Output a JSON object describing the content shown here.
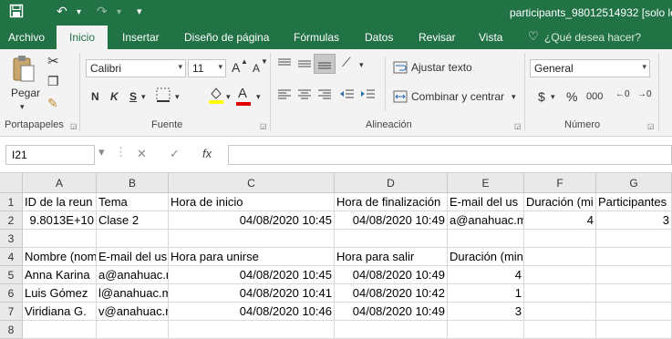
{
  "window": {
    "title": "participants_98012514932  [solo le"
  },
  "tabs": [
    "Archivo",
    "Inicio",
    "Insertar",
    "Diseño de página",
    "Fórmulas",
    "Datos",
    "Revisar",
    "Vista"
  ],
  "tell_me": "¿Qué desea hacer?",
  "ribbon": {
    "paste_label": "Pegar",
    "font_name": "Calibri",
    "font_size": "11",
    "grow_font": "A",
    "shrink_font": "A",
    "bold": "N",
    "italic": "K",
    "underline": "S",
    "wrap_text": "Ajustar texto",
    "merge_center": "Combinar y centrar",
    "number_format": "General",
    "currency": "$",
    "percent": "%",
    "thousands": "000",
    "groups": {
      "clipboard": "Portapapeles",
      "font": "Fuente",
      "alignment": "Alineación",
      "number": "Número"
    }
  },
  "formula_bar": {
    "name_box": "I21",
    "cancel": "✕",
    "enter": "✓",
    "fx": "fx",
    "value": ""
  },
  "columns": [
    "A",
    "B",
    "C",
    "D",
    "E",
    "F",
    "G"
  ],
  "rows": [
    {
      "num": "1",
      "cells": [
        "ID de la reun",
        "Tema",
        "Hora de inicio",
        "Hora de finalización",
        "E-mail del us",
        "Duración (mi",
        "Participantes"
      ]
    },
    {
      "num": "2",
      "cells": [
        "9.8013E+10",
        "Clase 2",
        "04/08/2020 10:45",
        "04/08/2020 10:49",
        "a@anahuac.m",
        "4",
        "3"
      ]
    },
    {
      "num": "3",
      "cells": [
        "",
        "",
        "",
        "",
        "",
        "",
        ""
      ]
    },
    {
      "num": "4",
      "cells": [
        "Nombre (nom",
        "E-mail del us",
        "Hora para unirse",
        "Hora para salir",
        "Duración (minutos)",
        "",
        ""
      ]
    },
    {
      "num": "5",
      "cells": [
        "Anna Karina",
        "a@anahuac.m",
        "04/08/2020 10:45",
        "04/08/2020 10:49",
        "4",
        "",
        ""
      ]
    },
    {
      "num": "6",
      "cells": [
        "Luis Gómez",
        "l@anahuac.m",
        "04/08/2020 10:41",
        "04/08/2020 10:42",
        "1",
        "",
        ""
      ]
    },
    {
      "num": "7",
      "cells": [
        "Viridiana G.",
        "v@anahuac.m",
        "04/08/2020 10:46",
        "04/08/2020 10:49",
        "3",
        "",
        ""
      ]
    },
    {
      "num": "8",
      "cells": [
        "",
        "",
        "",
        "",
        "",
        "",
        ""
      ]
    }
  ],
  "colors": {
    "excel_green": "#217346",
    "ribbon_bg": "#f3f3f3",
    "header_bg": "#e9e9e9"
  }
}
